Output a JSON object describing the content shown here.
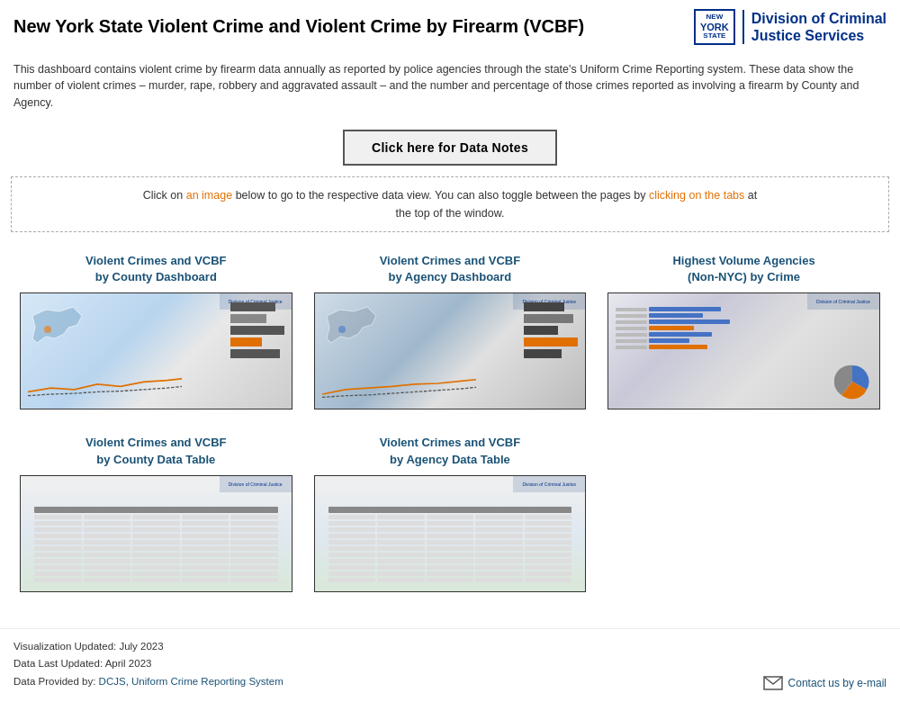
{
  "header": {
    "title": "New York State Violent Crime and Violent Crime by Firearm (VCBF)",
    "logo_line1": "NEW",
    "logo_line2": "YORK",
    "logo_line3": "STATE",
    "dcjs_line1": "Division of Criminal",
    "dcjs_line2": "Justice Services"
  },
  "description": {
    "text": "This dashboard contains violent crime by firearm data annually as reported by police agencies through the state's Uniform Crime Reporting system. These data show the number of violent crimes – murder, rape, robbery and aggravated assault – and the number and percentage of those crimes reported as involving a firearm by County and Agency."
  },
  "data_notes_button": {
    "label": "Click here for Data Notes"
  },
  "toggle_instruction": {
    "text1": "Click on an image below to go to the respective data view. You can also toggle between the pages by clicking on the tabs at",
    "text2": "the top of the window."
  },
  "dashboards": [
    {
      "id": "county-dashboard",
      "title_line1": "Violent Crimes and VCBF",
      "title_line2": "by County Dashboard",
      "type": "county"
    },
    {
      "id": "agency-dashboard",
      "title_line1": "Violent Crimes and VCBF",
      "title_line2": "by Agency Dashboard",
      "type": "agency"
    },
    {
      "id": "highvol-dashboard",
      "title_line1": "Highest Volume Agencies",
      "title_line2": "(Non-NYC) by Crime",
      "type": "highvol"
    },
    {
      "id": "county-table",
      "title_line1": "Violent Crimes and VCBF",
      "title_line2": "by County Data Table",
      "type": "countytable"
    },
    {
      "id": "agency-table",
      "title_line1": "Violent Crimes and VCBF",
      "title_line2": "by Agency Data Table",
      "type": "agencytable"
    }
  ],
  "footer": {
    "viz_updated_label": "Visualization Updated: ",
    "viz_updated_value": "July 2023",
    "data_updated_label": "Data Last Updated: ",
    "data_updated_value": "April 2023",
    "data_provided_label": "Data Provided by: ",
    "data_provided_link": "DCJS, Uniform Crime Reporting System",
    "contact_label": "Contact us by e-mail"
  }
}
